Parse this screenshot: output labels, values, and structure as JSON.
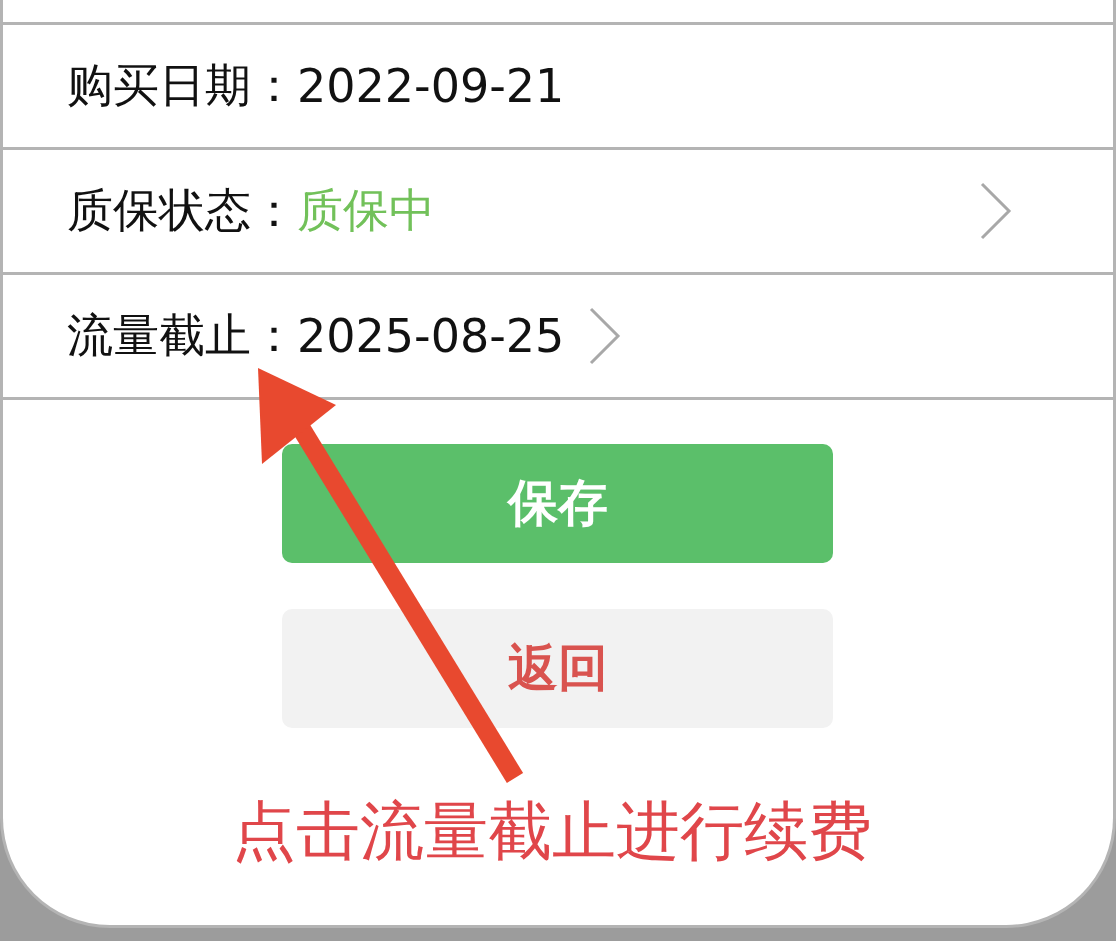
{
  "fields": [
    {
      "label": "购买日期：",
      "value": "2022-09-21",
      "kind": "plain",
      "chevron": false
    },
    {
      "label": "质保状态：",
      "value": "质保中",
      "kind": "status",
      "chevron": true
    },
    {
      "label": "流量截止：",
      "value": "2025-08-25",
      "kind": "plain",
      "chevron": true
    }
  ],
  "buttons": [
    {
      "label": "保存",
      "kind": "primary"
    },
    {
      "label": "返回",
      "kind": "secondary"
    }
  ],
  "annotation": {
    "text": "点击流量截止进行续费"
  }
}
